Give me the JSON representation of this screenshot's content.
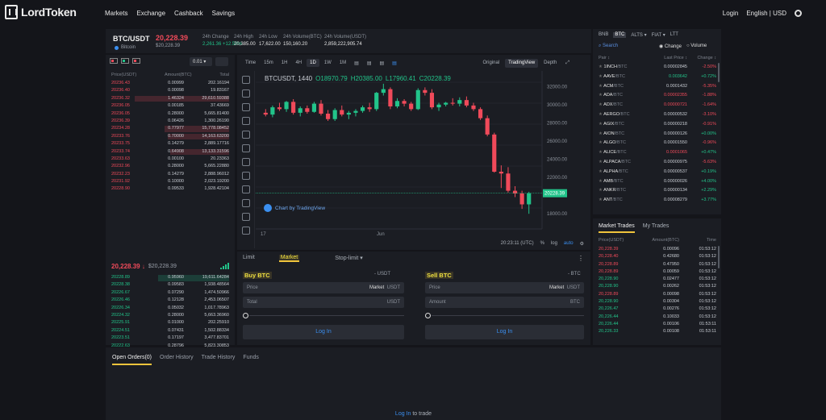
{
  "brand": "LordToken",
  "nav": [
    "Markets",
    "Exchange",
    "Cashback",
    "Savings"
  ],
  "top_right": {
    "login": "Login",
    "lang_currency": "English | USD"
  },
  "ticker": {
    "pair": "BTC/USDT",
    "coin": "Bitcoin",
    "price": "20,228.39",
    "price_sub": "$20,228.39",
    "stats": [
      {
        "label": "24h Change",
        "value": "2,261.36 +12.59%"
      },
      {
        "label": "24h High",
        "value": "20,385.00"
      },
      {
        "label": "24h Low",
        "value": "17,622.00"
      },
      {
        "label": "24h Volume(BTC)",
        "value": "150,160.20"
      },
      {
        "label": "24h Volume(USDT)",
        "value": "2,859,222,905.74"
      }
    ]
  },
  "orderbook": {
    "precision": "0.01 ▾",
    "cols": [
      "Price(USDT)",
      "Amount(BTC)",
      "Total"
    ],
    "asks": [
      [
        "20236.43",
        "0.00999",
        "202.16194",
        0
      ],
      [
        "20236.40",
        "0.00098",
        "19.83167",
        0
      ],
      [
        "20236.32",
        "1.46324",
        "29,610.59388",
        0.8
      ],
      [
        "20236.05",
        "0.00185",
        "37.43669",
        0
      ],
      [
        "20236.05",
        "0.28000",
        "5,665.81400",
        0
      ],
      [
        "20236.39",
        "0.06426",
        "1,300.26190",
        0
      ],
      [
        "20234.28",
        "0.77977",
        "15,778.08452",
        0.55
      ],
      [
        "20233.76",
        "0.70000",
        "14,163.63200",
        0.52
      ],
      [
        "20233.75",
        "0.14279",
        "2,889.17716",
        0
      ],
      [
        "20233.74",
        "0.64908",
        "13,133.31596",
        0.5
      ],
      [
        "20233.63",
        "0.00100",
        "20.23363",
        0
      ],
      [
        "20232.96",
        "0.28000",
        "5,665.22880",
        0
      ],
      [
        "20232.23",
        "0.14279",
        "2,888.96012",
        0
      ],
      [
        "20231.92",
        "0.10000",
        "2,023.19200",
        0
      ],
      [
        "20228.90",
        "0.09533",
        "1,928.42104",
        0
      ]
    ],
    "mid_price": "20,228.39 ↓",
    "mid_usd": "$20,228.39",
    "bids": [
      [
        "20228.89",
        "0.95960",
        "19,611.64284",
        0.6
      ],
      [
        "20228.38",
        "0.09583",
        "1,938.48564",
        0
      ],
      [
        "20226.67",
        "0.07290",
        "1,474.50966",
        0
      ],
      [
        "20226.46",
        "0.12128",
        "2,453.06507",
        0
      ],
      [
        "20226.34",
        "0.05032",
        "1,017.78963",
        0
      ],
      [
        "20224.32",
        "0.28000",
        "5,663.36960",
        0
      ],
      [
        "20225.91",
        "0.01000",
        "202.25910",
        0
      ],
      [
        "20224.51",
        "0.07431",
        "1,502.88334",
        0
      ],
      [
        "20223.51",
        "0.17197",
        "3,477.83701",
        0
      ],
      [
        "20222.63",
        "0.28796",
        "5,823.30853",
        0
      ],
      [
        "20222.45",
        "0.02410",
        "487.35986",
        0
      ],
      [
        "20222.39",
        "0.28000",
        "5,662.26920",
        0
      ],
      [
        "20222.37",
        "0.00840",
        "169.86791",
        0
      ],
      [
        "20222.30",
        "0.00100",
        "20.22230",
        0
      ],
      [
        "20222.19",
        "0.01000",
        "202.22190",
        0
      ]
    ]
  },
  "chart": {
    "intervals": [
      "Time",
      "15m",
      "1H",
      "4H",
      "1D",
      "1W",
      "1M"
    ],
    "active_interval": "1D",
    "views": [
      "Original",
      "TradingView",
      "Depth"
    ],
    "active_view": "TradingView",
    "symbol": "BTCUSDT, 1440",
    "o": "O18970.79",
    "h": "H20385.00",
    "l": "L17960.41",
    "c": "C20228.39",
    "price_axis": [
      "32000.00",
      "30000.00",
      "28000.00",
      "26000.00",
      "24000.00",
      "22000.00",
      "18000.00"
    ],
    "current_price_tag": "20228.39",
    "time_axis": [
      "17",
      "Jun"
    ],
    "watermark": "Chart by TradingView",
    "footer": {
      "time": "20:23:11 (UTC)",
      "pct": "%",
      "log": "log",
      "auto": "auto"
    }
  },
  "chart_data": {
    "type": "candlestick",
    "symbol": "BTCUSDT",
    "interval": "1D",
    "ylim": [
      17000,
      33000
    ],
    "candles": [
      [
        29100,
        29500,
        28700,
        28900
      ],
      [
        28900,
        29900,
        28600,
        29700
      ],
      [
        29700,
        30200,
        29300,
        29500
      ],
      [
        29500,
        30400,
        29200,
        30300
      ],
      [
        30300,
        30600,
        28900,
        29100
      ],
      [
        29100,
        29800,
        28700,
        29600
      ],
      [
        29600,
        29900,
        29000,
        29200
      ],
      [
        29200,
        30300,
        29100,
        30100
      ],
      [
        30100,
        30500,
        28800,
        29000
      ],
      [
        29000,
        29400,
        28200,
        28400
      ],
      [
        28400,
        29600,
        28200,
        29400
      ],
      [
        29400,
        29900,
        28700,
        28900
      ],
      [
        28900,
        29300,
        28400,
        29100
      ],
      [
        29100,
        29500,
        28700,
        29300
      ],
      [
        29300,
        29900,
        29100,
        29700
      ],
      [
        29700,
        30200,
        29200,
        29500
      ],
      [
        29500,
        31400,
        29300,
        31300
      ],
      [
        31300,
        32300,
        31000,
        31700
      ],
      [
        31700,
        31900,
        29500,
        29800
      ],
      [
        29800,
        30700,
        29600,
        30400
      ],
      [
        30400,
        30600,
        29800,
        30100
      ],
      [
        30100,
        30300,
        29300,
        29500
      ],
      [
        29500,
        31800,
        29400,
        31600
      ],
      [
        31600,
        31900,
        31000,
        31300
      ],
      [
        31300,
        31700,
        29500,
        29700
      ],
      [
        29700,
        30200,
        29300,
        30000
      ],
      [
        30000,
        30300,
        29800,
        30200
      ],
      [
        30200,
        30700,
        29900,
        30100
      ],
      [
        30100,
        30800,
        29800,
        30500
      ],
      [
        30500,
        30900,
        29700,
        29900
      ],
      [
        29900,
        30200,
        29300,
        29500
      ],
      [
        29500,
        29700,
        28300,
        28500
      ],
      [
        28500,
        28800,
        26500,
        26700
      ],
      [
        26700,
        26900,
        22500,
        22600
      ],
      [
        22600,
        23300,
        20800,
        22400
      ],
      [
        22400,
        23100,
        20300,
        20500
      ],
      [
        20500,
        21000,
        19800,
        20200
      ],
      [
        20200,
        20500,
        18500,
        19000
      ],
      [
        19000,
        20385,
        17960,
        20228
      ]
    ]
  },
  "trade": {
    "tabs": [
      "Limit",
      "Market",
      "Stop-limit ▾"
    ],
    "active_tab": "Market",
    "buy": {
      "title": "Buy BTC",
      "avail": "- USDT",
      "f1_label": "Price",
      "f1_value": "Market",
      "f1_unit": "USDT",
      "f2_label": "Total",
      "f2_unit": "USDT",
      "btn": "Log In"
    },
    "sell": {
      "title": "Sell BTC",
      "avail": "- BTC",
      "f1_label": "Price",
      "f1_value": "Market",
      "f1_unit": "USDT",
      "f2_label": "Amount",
      "f2_unit": "BTC",
      "btn": "Log In"
    }
  },
  "market": {
    "tabs": [
      "BNB",
      "BTC",
      "ALTS ▾",
      "FIAT ▾",
      "LTT"
    ],
    "active_tab": "BTC",
    "search": "Search",
    "radio": [
      "Change",
      "Volume"
    ],
    "cols": [
      "Pair ↕",
      "Last Price ↕",
      "Change ↕"
    ],
    "rows": [
      [
        "1INCH",
        "0.00002845",
        "-2.50%",
        "n",
        "r"
      ],
      [
        "AAVE",
        "0.003642",
        "+0.72%",
        "g",
        "g"
      ],
      [
        "ACM",
        "0.0001432",
        "-5.35%",
        "n",
        "r"
      ],
      [
        "ADA",
        "0.00002355",
        "-1.88%",
        "r",
        "r"
      ],
      [
        "ADX",
        "0.00000721",
        "-1.64%",
        "r",
        "r"
      ],
      [
        "AERGO",
        "0.00000532",
        "-3.10%",
        "n",
        "r"
      ],
      [
        "AGIX",
        "0.00000218",
        "-0.91%",
        "n",
        "r"
      ],
      [
        "AION",
        "0.00000126",
        "+0.00%",
        "n",
        "g"
      ],
      [
        "ALGO",
        "0.00001550",
        "-0.96%",
        "n",
        "r"
      ],
      [
        "ALICE",
        "0.0001065",
        "+0.47%",
        "r",
        "g"
      ],
      [
        "ALPACA",
        "0.00000975",
        "-5.63%",
        "n",
        "r"
      ],
      [
        "ALPHA",
        "0.00000537",
        "+0.19%",
        "n",
        "g"
      ],
      [
        "AMB",
        "0.00000026",
        "+4.00%",
        "n",
        "g"
      ],
      [
        "ANKR",
        "0.00000134",
        "+2.29%",
        "n",
        "g"
      ],
      [
        "ANT",
        "0.00008279",
        "+3.77%",
        "n",
        "g"
      ]
    ],
    "pair_suffix": "/BTC"
  },
  "market_trades": {
    "tabs": [
      "Market Trades",
      "My Trades"
    ],
    "cols": [
      "Price(USDT)",
      "Amount(BTC)",
      "Time"
    ],
    "rows": [
      [
        "20,228.39",
        "0.00096",
        "01:53:12",
        "r"
      ],
      [
        "20,228.40",
        "0.42680",
        "01:53:12",
        "r"
      ],
      [
        "20,228.89",
        "0.47950",
        "01:53:12",
        "r"
      ],
      [
        "20,228.89",
        "0.00059",
        "01:53:12",
        "r"
      ],
      [
        "20,228.90",
        "0.02477",
        "01:53:12",
        "g"
      ],
      [
        "20,228.90",
        "0.00262",
        "01:53:12",
        "g"
      ],
      [
        "20,228.89",
        "0.00098",
        "01:53:12",
        "r"
      ],
      [
        "20,228.90",
        "0.00304",
        "01:53:12",
        "g"
      ],
      [
        "20,226.47",
        "0.00276",
        "01:53:12",
        "g"
      ],
      [
        "20,226.44",
        "0.10033",
        "01:53:12",
        "g"
      ],
      [
        "20,226.44",
        "0.00106",
        "01:53:11",
        "g"
      ],
      [
        "20,226.33",
        "0.00108",
        "01:53:11",
        "g"
      ]
    ]
  },
  "orders": {
    "tabs": [
      "Open Orders(0)",
      "Order History",
      "Trade History",
      "Funds"
    ],
    "empty_link": "Log In",
    "empty_rest": " to trade"
  }
}
